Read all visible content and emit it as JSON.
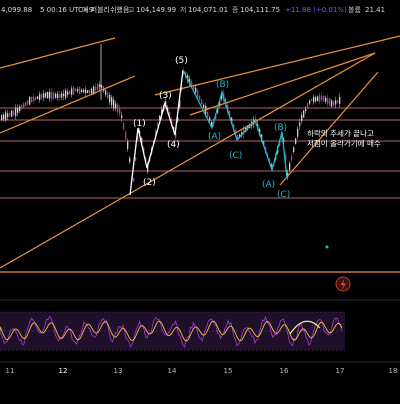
{
  "header": {
    "left_price": "4,099.88",
    "time_label": "5 00:16 UTC+9",
    "exchange": "예 퍼블리쉬했음",
    "high_label": "고",
    "high_value": "104,149.99",
    "low_label": "저",
    "low_value": "104,071.01",
    "close_label": "종",
    "close_value": "104,111.75",
    "change": "+11.88 (+0.01%)",
    "volume_label": "볼륨",
    "volume_value": "21.41"
  },
  "annotation": {
    "line1": "하락의 추세가 끝나고",
    "line2": "저점이 올라가기에 매수"
  },
  "colors": {
    "background": "#000000",
    "up_candle": "#b13fa8",
    "down_candle": "#cfcfd6",
    "trend_line": "#e8923a",
    "horizontal_line": "#b8606e",
    "white_label": "#ffffff",
    "cyan_label": "#27b5c9",
    "rsi_line": "#a93cc9",
    "rsi_signal": "#f0c040",
    "rsi_band": "#2a1538",
    "alert_icon": "#c0392b"
  },
  "chart_data": {
    "type": "candlestick",
    "x_ticks": [
      "11",
      "12",
      "13",
      "14",
      "15",
      "16",
      "17",
      "18"
    ],
    "wave_labels_white": [
      "(1)",
      "(2)",
      "(3)",
      "(4)",
      "(5)"
    ],
    "wave_labels_cyan_first": [
      "(A)",
      "(B)",
      "(C)"
    ],
    "wave_labels_cyan_second": [
      "(A)",
      "(B)",
      "(C)"
    ],
    "grid": false
  }
}
